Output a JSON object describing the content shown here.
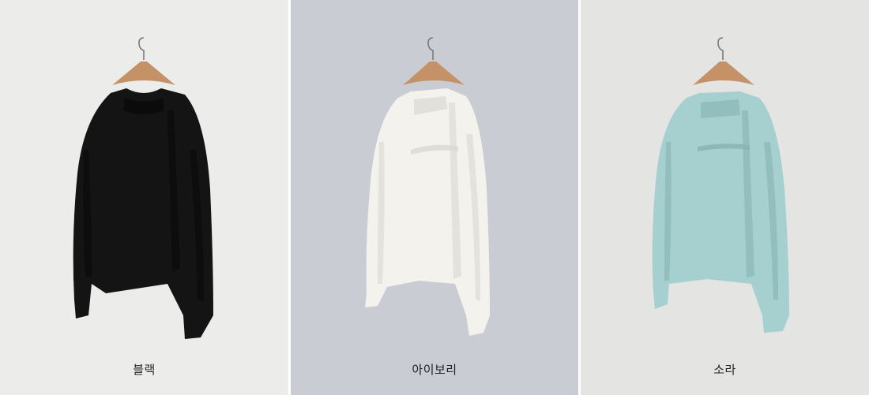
{
  "products": [
    {
      "caption": "블랙",
      "bg_color": "#ececea",
      "garment_color": "#141414",
      "shadow_color": "#050505",
      "icon": "blouse-photo"
    },
    {
      "caption": "아이보리",
      "bg_color": "#c9ccd3",
      "garment_color": "#f3f2ec",
      "shadow_color": "#d9d8d1",
      "icon": "blouse-photo"
    },
    {
      "caption": "소라",
      "bg_color": "#e4e4e2",
      "garment_color": "#a6cfcf",
      "shadow_color": "#86b2b3",
      "icon": "blouse-photo"
    }
  ]
}
